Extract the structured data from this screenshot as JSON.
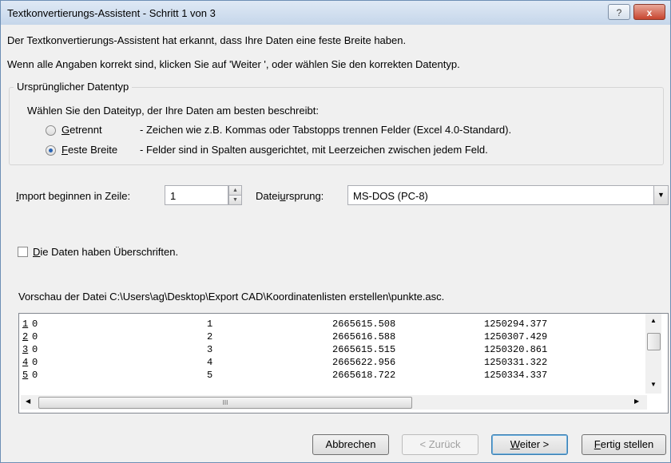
{
  "window": {
    "title": "Textkonvertierungs-Assistent - Schritt 1 von 3",
    "help_label": "?",
    "close_label": "x"
  },
  "intro": {
    "line1": "Der Textkonvertierungs-Assistent hat erkannt, dass Ihre Daten eine feste Breite haben.",
    "line2": "Wenn alle Angaben korrekt sind, klicken Sie auf 'Weiter ', oder wählen Sie den korrekten Datentyp."
  },
  "datatype": {
    "legend": "Ursprünglicher Datentyp",
    "prompt": "Wählen Sie den Dateityp, der Ihre Daten am besten beschreibt:",
    "options": [
      {
        "label": "Getrennt",
        "desc": "- Zeichen wie z.B. Kommas oder Tabstopps trennen Felder (Excel 4.0-Standard).",
        "selected": false
      },
      {
        "label": "Feste Breite",
        "desc": "- Felder sind in Spalten ausgerichtet, mit Leerzeichen zwischen jedem Feld.",
        "selected": true
      }
    ]
  },
  "import_row": {
    "label": "Import beginnen in Zeile:",
    "value": "1"
  },
  "origin": {
    "label": "Dateiursprung:",
    "value": "MS-DOS (PC-8)"
  },
  "headers_checkbox": {
    "label": "Die Daten haben Überschriften.",
    "checked": false
  },
  "preview": {
    "label": "Vorschau der Datei C:\\Users\\ag\\Desktop\\Export CAD\\Koordinatenlisten erstellen\\punkte.asc.",
    "rows": [
      {
        "num": "1",
        "c1": "0",
        "c2": "1",
        "c3": "2665615.508",
        "c4": "1250294.377"
      },
      {
        "num": "2",
        "c1": "0",
        "c2": "2",
        "c3": "2665616.588",
        "c4": "1250307.429"
      },
      {
        "num": "3",
        "c1": "0",
        "c2": "3",
        "c3": "2665615.515",
        "c4": "1250320.861"
      },
      {
        "num": "4",
        "c1": "0",
        "c2": "4",
        "c3": "2665622.956",
        "c4": "1250331.322"
      },
      {
        "num": "5",
        "c1": "0",
        "c2": "5",
        "c3": "2665618.722",
        "c4": "1250334.337"
      }
    ],
    "hscroll_grip": "III"
  },
  "buttons": {
    "cancel": "Abbrechen",
    "back": "< Zurück",
    "next": "Weiter >",
    "finish": "Fertig stellen"
  }
}
